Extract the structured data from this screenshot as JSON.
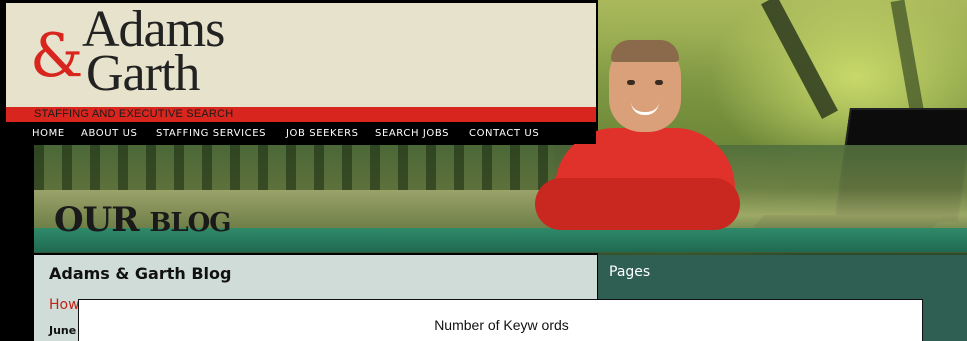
{
  "brand": {
    "logo_line1": "Adams",
    "logo_ampersand": "&",
    "logo_line2": "Garth",
    "tagline": "STAFFING AND EXECUTIVE SEARCH"
  },
  "nav": {
    "items": [
      {
        "label": "HOME"
      },
      {
        "label": "ABOUT US"
      },
      {
        "label": "STAFFING SERVICES"
      },
      {
        "label": "JOB SEEKERS"
      },
      {
        "label": "SEARCH JOBS"
      },
      {
        "label": "CONTACT US"
      }
    ]
  },
  "banner": {
    "title_our": "OUR",
    "title_blog": "BLOG"
  },
  "main": {
    "blog_name": "Adams & Garth Blog",
    "post_title_partial": "How",
    "post_date_partial": "June"
  },
  "sidebar": {
    "pages_heading": "Pages"
  },
  "dialog": {
    "title": "Number of Keyw ords"
  },
  "colors": {
    "brand_red": "#d8261e",
    "nav_bg": "#000000",
    "header_bg": "#e7e2cc",
    "sidebar_bg": "#2f5e52",
    "content_bg": "#cfdcd7"
  }
}
